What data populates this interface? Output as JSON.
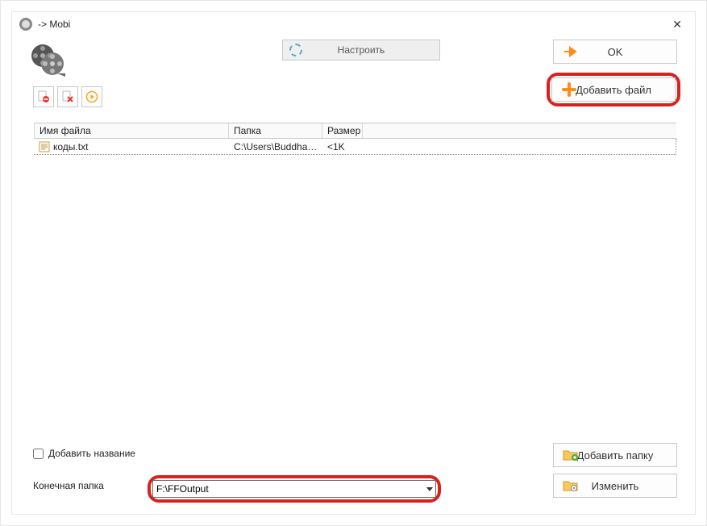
{
  "window": {
    "title": "-> Mobi"
  },
  "buttons": {
    "settings": "Настроить",
    "ok": "OK",
    "addfile": "Добавить файл",
    "addfolder": "Добавить папку",
    "change": "Изменить"
  },
  "table": {
    "headers": {
      "filename": "Имя файла",
      "folder": "Папка",
      "size": "Размер"
    },
    "rows": [
      {
        "filename": "коды.txt",
        "folder": "C:\\Users\\Buddha\\D...",
        "size": "<1K"
      }
    ]
  },
  "checkbox": {
    "addtitle": "Добавить название"
  },
  "output": {
    "label": "Конечная папка",
    "path": "F:\\FFOutput"
  }
}
